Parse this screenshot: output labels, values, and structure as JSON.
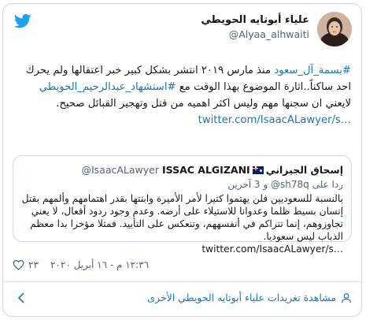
{
  "author": {
    "display_name": "علياء أبوتايه الحويطي",
    "handle": "@Alyaa_alhwaiti",
    "avatar_icon": "user-avatar-photo"
  },
  "platform_icon": "twitter-bird-icon",
  "colors": {
    "brand": "#1da1f2",
    "link": "#1b75bb",
    "muted": "#536471",
    "border": "#cfd9de"
  },
  "tweet": {
    "hashtag_1": "#بسمة_آل_سعود",
    "text_1": " منذ مارس ٢٠١٩ انتشر بشكل كبير خبر اعتقالها ولم يحرك احد ساكناً..اثارة الموضوع بهذا الوقت مع ",
    "hashtag_2": "#استشهاد_عبدالرحيم_الحويطي",
    "text_2": " لايعني ان سجنها مهم وليس اكثر اهميه من قتل وتهجير القبائل صحيح.",
    "url": "twitter.com/IsaacALawyer/s…"
  },
  "quoted_tweet": {
    "name_ar": "إسحاق الجيزاني",
    "name_en": "ISSAC ALGIZANI",
    "handle": "@IsaacALawyer",
    "flag_icon": "australia-flag-icon",
    "reply_prefix": "ردا على ",
    "reply_handle": "@sh78q",
    "reply_suffix": " و 3 آخرين",
    "text": "بالنسبة للسعوديين فلن يهتموا كثيرا لأمر الأميرة وابنتها بقدر اهتمامهم وألمهم بقتل إنسان بسيط ظلما وعدوانا للاستيلاء على أرضه. وعدم وجود ردود أفعال، لا يعني تجاوزوهم، إنما تتراكم في أنفسههم، وتنعكس على التأييد. فمثلا مؤخرا بدا معظم الذباب ليس سعوديا.",
    "url": "twitter.com/IsaacALawyer/s…"
  },
  "meta": {
    "likes": "٢٣",
    "timestamp": "١٢:٣٦ م - ١٦ أبريل ٢٠٢٠",
    "heart_icon": "heart-icon"
  },
  "footer": {
    "label": "مشاهدة تغريدات علياء أبوتايه الحويطي الأخرى",
    "person_icon": "person-icon",
    "chevron_icon": "chevron-left-icon"
  }
}
